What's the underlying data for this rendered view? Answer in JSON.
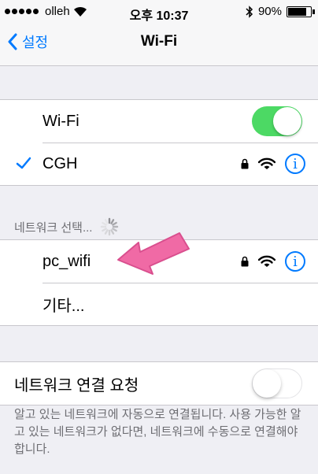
{
  "status_bar": {
    "carrier": "olleh",
    "time": "오후 10:37",
    "battery": "90%",
    "battery_level": 0.9
  },
  "nav": {
    "back_label": "설정",
    "title": "Wi-Fi"
  },
  "wifi_section": {
    "wifi_label": "Wi-Fi",
    "wifi_enabled": true,
    "connected_network": "CGH"
  },
  "choose_network": {
    "header": "네트워크 선택...",
    "networks": [
      {
        "name": "pc_wifi"
      }
    ],
    "other_label": "기타..."
  },
  "ask_to_join": {
    "label": "네트워크 연결 요청",
    "enabled": false,
    "description": "알고 있는 네트워크에 자동으로 연결됩니다. 사용 가능한 알고 있는 네트워크가 없다면, 네트워크에 수동으로 연결해야 합니다."
  },
  "icons": {
    "lock": "lock-icon",
    "wifi": "wifi-signal-icon",
    "info": "info-icon",
    "check": "checkmark-icon"
  },
  "colors": {
    "accent": "#007aff",
    "toggle_on": "#4cd964",
    "arrow": "#f06aa5"
  }
}
